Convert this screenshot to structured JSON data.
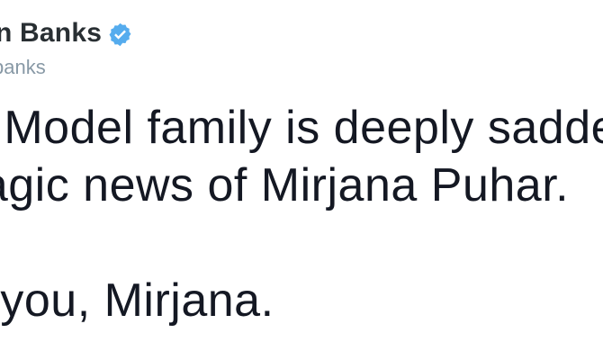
{
  "tweet": {
    "display_name": "n Banks",
    "handle": "banks",
    "verified_icon": "verified-badge-icon",
    "lines": [
      "o Model family is deeply sadde",
      "ragic news of Mirjana Puhar.",
      "",
      "e you, Mirjana."
    ]
  },
  "colors": {
    "name": "#292f33",
    "handle": "#8899a6",
    "text": "#141823",
    "verified": "#55acee"
  }
}
